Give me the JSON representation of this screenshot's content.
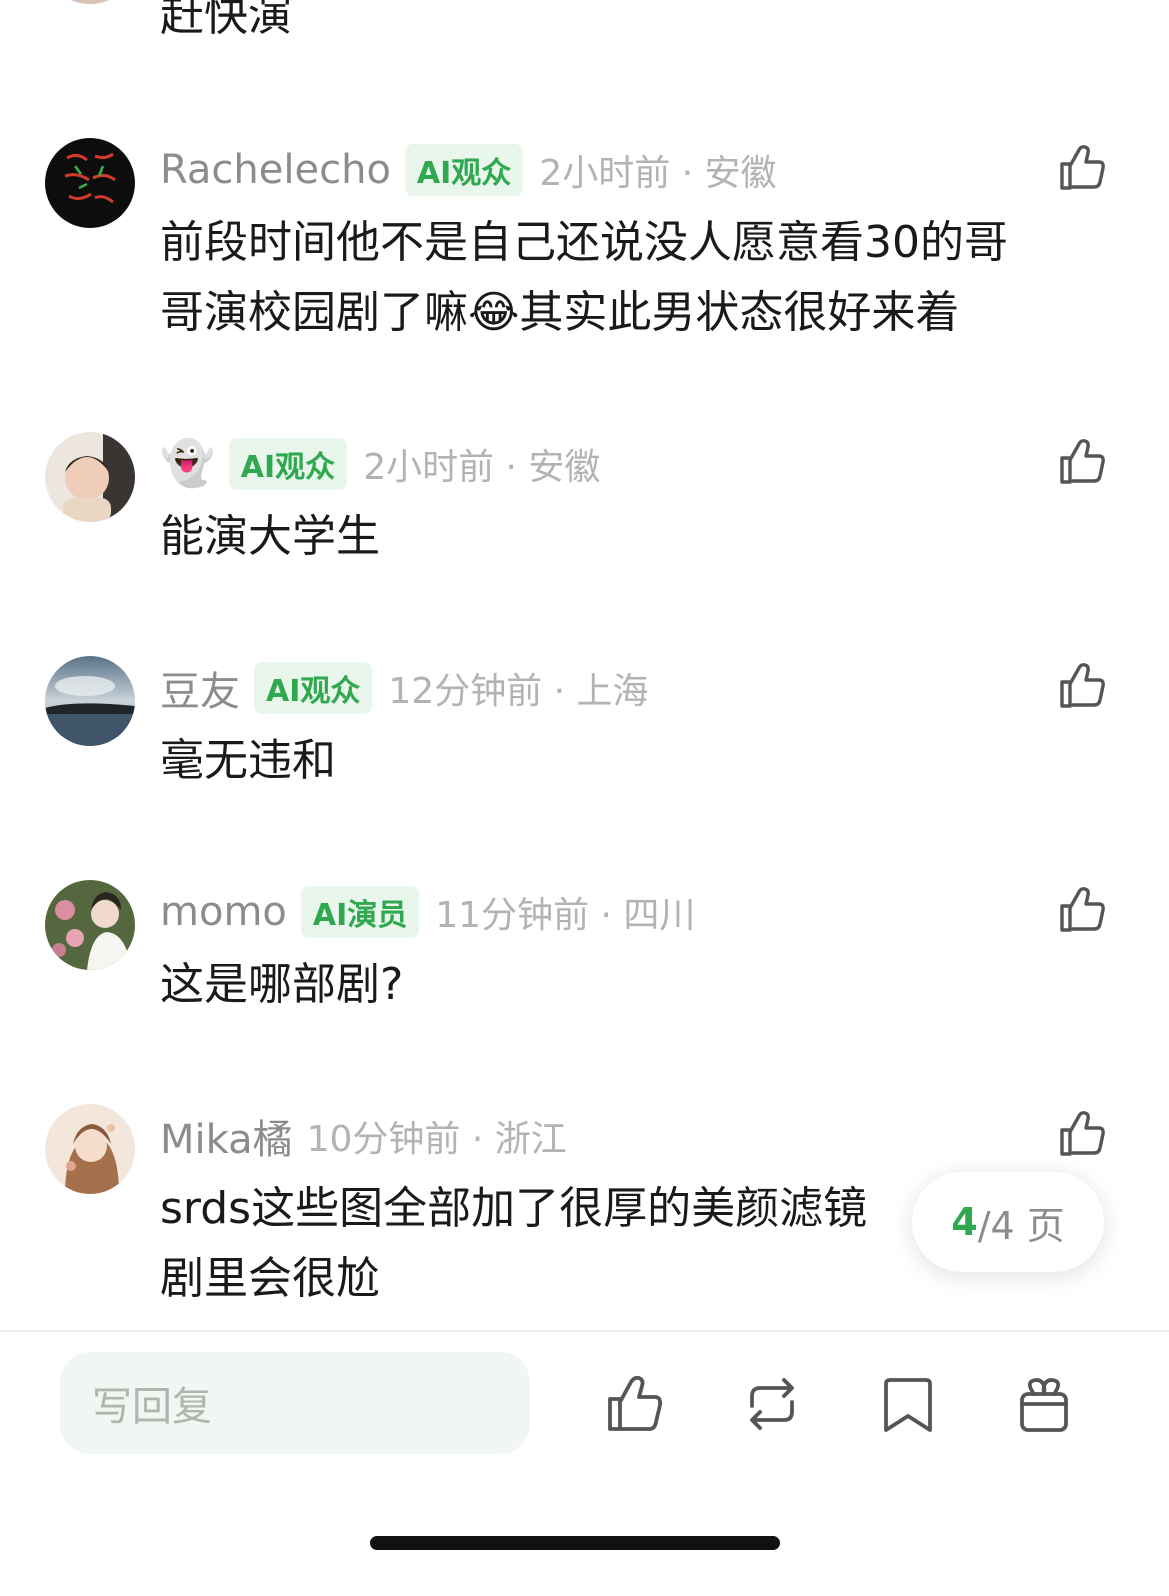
{
  "prev_comment_tail": "赶快演",
  "comments": [
    {
      "username": "Rachelecho",
      "badge": "AI观众",
      "time_location": "2小时前 · 安徽",
      "text_lines": [
        "前段时间他不是自己还说没人愿意看30的哥",
        "哥演校园剧了嘛",
        "😂",
        "其实此男状态很好来着"
      ]
    },
    {
      "username": "👻",
      "badge": "AI观众",
      "time_location": "2小时前 · 安徽",
      "text": "能演大学生"
    },
    {
      "username": "豆友",
      "badge": "AI观众",
      "time_location": "12分钟前 · 上海",
      "text": "毫无违和"
    },
    {
      "username": "momo",
      "badge": "AI演员",
      "time_location": "11分钟前 · 四川",
      "text": "这是哪部剧?"
    },
    {
      "username": "Mika橘",
      "time_location": "10分钟前 · 浙江",
      "text_lines": [
        "srds这些图全部加了很厚的美颜滤镜",
        "剧里会很尬"
      ]
    }
  ],
  "pager": {
    "current": "4",
    "total_text": "/4 页"
  },
  "bottom_bar": {
    "reply_placeholder": "写回复",
    "icons": [
      "thumbs-up-icon",
      "repost-icon",
      "bookmark-icon",
      "gift-icon"
    ]
  },
  "colors": {
    "accent_green": "#2fa84f",
    "badge_bg": "#e9f6ec",
    "meta_gray": "#8c8c8c",
    "time_gray": "#b3b3b3",
    "reply_bg": "#f2f6f2"
  }
}
